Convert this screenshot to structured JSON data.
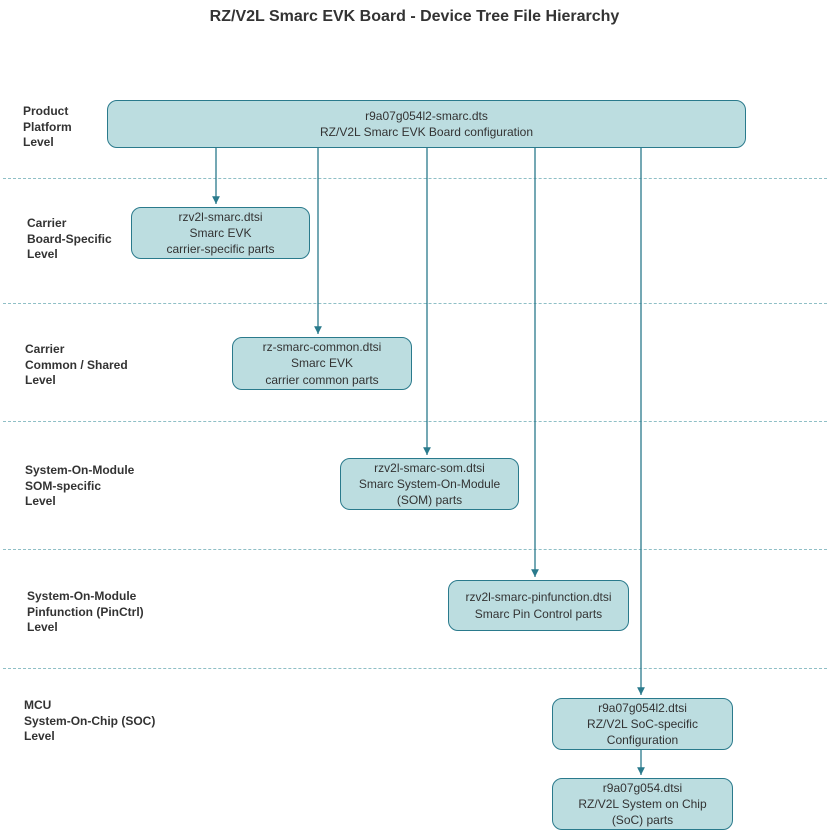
{
  "title": "RZ/V2L Smarc EVK Board - Device Tree File Hierarchy",
  "levels": {
    "product": "Product\nPlatform\nLevel",
    "carrier_specific": "Carrier\nBoard-Specific\nLevel",
    "carrier_common": "Carrier\nCommon /  Shared\nLevel",
    "som_specific": "System-On-Module\nSOM-specific\nLevel",
    "som_pinctrl": "System-On-Module\nPinfunction (PinCtrl)\nLevel",
    "mcu_soc": "MCU\nSystem-On-Chip  (SOC)\nLevel"
  },
  "nodes": {
    "top": {
      "file": "r9a07g054l2-smarc.dts",
      "desc": "RZ/V2L Smarc EVK Board configuration"
    },
    "carrier_specific": {
      "file": "rzv2l-smarc.dtsi",
      "desc1": "Smarc EVK",
      "desc2": "carrier-specific parts"
    },
    "carrier_common": {
      "file": "rz-smarc-common.dtsi",
      "desc1": "Smarc EVK",
      "desc2": "carrier common parts"
    },
    "som": {
      "file": "rzv2l-smarc-som.dtsi",
      "desc1": "Smarc System-On-Module",
      "desc2": "(SOM) parts"
    },
    "pinfunction": {
      "file": "rzv2l-smarc-pinfunction.dtsi",
      "desc": "Smarc Pin Control parts"
    },
    "soc_specific": {
      "file": "r9a07g054l2.dtsi",
      "desc1": "RZ/V2L SoC-specific",
      "desc2": "Configuration"
    },
    "soc_parts": {
      "file": "r9a07g054.dtsi",
      "desc1": "RZ/V2L System on Chip",
      "desc2": "(SoC) parts"
    }
  },
  "colors": {
    "node_fill": "#bcdde0",
    "node_border": "#2a7a8c",
    "divider": "#8fbfc6",
    "arrow": "#2a7a8c"
  }
}
